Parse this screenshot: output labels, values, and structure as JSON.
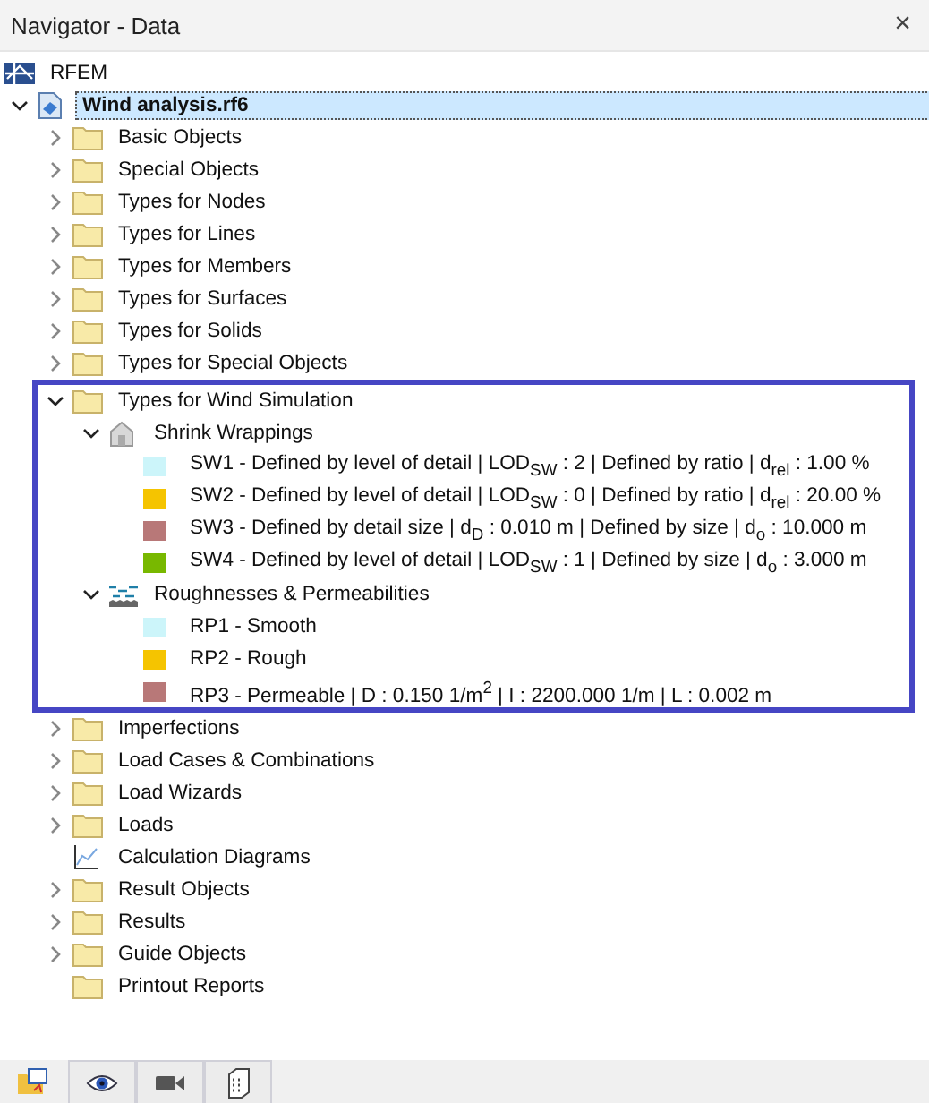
{
  "window": {
    "title": "Navigator - Data",
    "close": "×"
  },
  "tree": [
    {
      "label": "RFEM",
      "kind": "rfem",
      "selected": false,
      "children": [
        {
          "label": "Wind analysis.rf6",
          "kind": "model",
          "selected": true,
          "expanded": true,
          "children": [
            {
              "label": "Basic Objects",
              "kind": "folder",
              "selected": false,
              "expanded": false
            },
            {
              "label": "Special Objects",
              "kind": "folder",
              "selected": false,
              "expanded": false
            },
            {
              "label": "Types for Nodes",
              "kind": "folder",
              "selected": false,
              "expanded": false
            },
            {
              "label": "Types for Lines",
              "kind": "folder",
              "selected": false,
              "expanded": false
            },
            {
              "label": "Types for Members",
              "kind": "folder",
              "selected": false,
              "expanded": false
            },
            {
              "label": "Types for Surfaces",
              "kind": "folder",
              "selected": false,
              "expanded": false
            },
            {
              "label": "Types for Solids",
              "kind": "folder",
              "selected": false,
              "expanded": false
            },
            {
              "label": "Types for Special Objects",
              "kind": "folder",
              "selected": false,
              "expanded": false
            },
            {
              "label": "Types for Wind Simulation",
              "kind": "folder",
              "selected": false,
              "expanded": true,
              "highlighted": true,
              "children": [
                {
                  "label": "Shrink Wrappings",
                  "kind": "shrink",
                  "selected": false,
                  "expanded": true,
                  "children": [
                    {
                      "label": "SW1 - Defined by level of detail | LOD$_{SW}$ : 2 | Defined by ratio | d$_{rel}$ : 1.00 %",
                      "kind": "color",
                      "color": "#ccf5fa",
                      "selected": false
                    },
                    {
                      "label": "SW2 - Defined by level of detail | LOD$_{SW}$ : 0 | Defined by ratio | d$_{rel}$ : 20.00 %",
                      "kind": "color",
                      "color": "#f5c400",
                      "selected": false
                    },
                    {
                      "label": "SW3 - Defined by detail size | d$_{D}$ : 0.010 m | Defined by size | d$_{o}$ : 10.000 m",
                      "kind": "color",
                      "color": "#b87878",
                      "selected": false
                    },
                    {
                      "label": "SW4 - Defined by level of detail | LOD$_{SW}$ : 1 | Defined by size | d$_{o}$ : 3.000 m",
                      "kind": "color",
                      "color": "#78b800",
                      "selected": false
                    }
                  ]
                },
                {
                  "label": "Roughnesses & Permeabilities",
                  "kind": "roughness",
                  "selected": false,
                  "expanded": true,
                  "children": [
                    {
                      "label": "RP1 - Smooth",
                      "kind": "color",
                      "color": "#ccf5fa",
                      "selected": false
                    },
                    {
                      "label": "RP2 - Rough",
                      "kind": "color",
                      "color": "#f5c400",
                      "selected": false
                    },
                    {
                      "label": "RP3 - Permeable | D : 0.150 1/m$^{2}$ | I : 2200.000 1/m | L : 0.002 m",
                      "kind": "color",
                      "color": "#b87878",
                      "selected": false
                    }
                  ]
                }
              ]
            },
            {
              "label": "Imperfections",
              "kind": "folder",
              "selected": false,
              "expanded": false
            },
            {
              "label": "Load Cases & Combinations",
              "kind": "folder",
              "selected": false,
              "expanded": false
            },
            {
              "label": "Load Wizards",
              "kind": "folder",
              "selected": false,
              "expanded": false
            },
            {
              "label": "Loads",
              "kind": "folder",
              "selected": false,
              "expanded": false
            },
            {
              "label": "Calculation Diagrams",
              "kind": "diagram",
              "selected": false
            },
            {
              "label": "Result Objects",
              "kind": "folder",
              "selected": false,
              "expanded": false
            },
            {
              "label": "Results",
              "kind": "folder",
              "selected": false,
              "expanded": false
            },
            {
              "label": "Guide Objects",
              "kind": "folder",
              "selected": false,
              "expanded": false
            },
            {
              "label": "Printout Reports",
              "kind": "folder",
              "selected": false
            }
          ]
        }
      ]
    }
  ],
  "bottom_tabs": [
    {
      "kind": "display"
    },
    {
      "kind": "views"
    },
    {
      "kind": "building"
    }
  ]
}
